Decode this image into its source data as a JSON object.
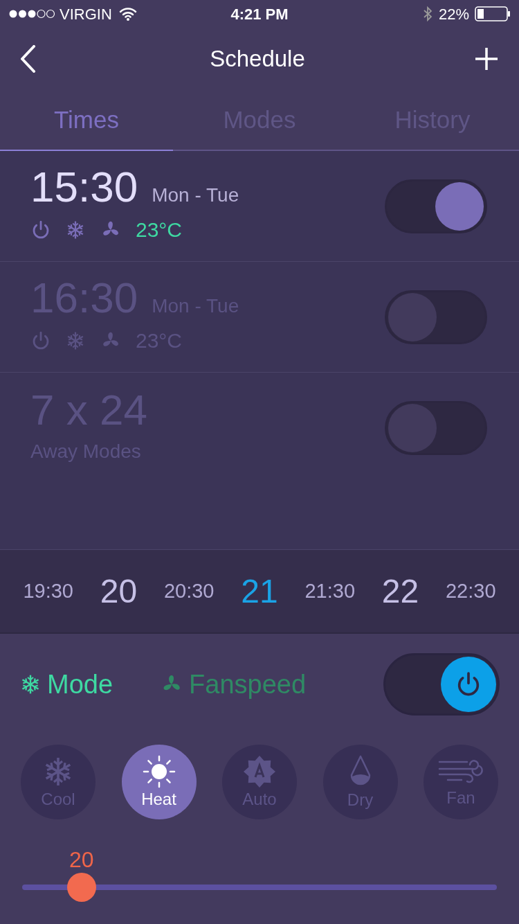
{
  "status_bar": {
    "carrier": "VIRGIN",
    "time": "4:21 PM",
    "battery": "22%"
  },
  "nav": {
    "title": "Schedule"
  },
  "tabs": [
    {
      "label": "Times",
      "selected": true
    },
    {
      "label": "Modes",
      "selected": false
    },
    {
      "label": "History",
      "selected": false
    }
  ],
  "schedules": [
    {
      "kind": "time",
      "time": "15:30",
      "days": "Mon - Tue",
      "temperature": "23°C",
      "on": true
    },
    {
      "kind": "time",
      "time": "16:30",
      "days": "Mon - Tue",
      "temperature": "23°C",
      "on": false
    },
    {
      "kind": "away",
      "title": "7 x 24",
      "subtitle": "Away Modes",
      "on": false
    }
  ],
  "timeline": [
    {
      "label": "19:30",
      "kind": "half",
      "selected": false
    },
    {
      "label": "20",
      "kind": "hour",
      "selected": false
    },
    {
      "label": "20:30",
      "kind": "half",
      "selected": false
    },
    {
      "label": "21",
      "kind": "hour",
      "selected": true
    },
    {
      "label": "21:30",
      "kind": "half",
      "selected": false
    },
    {
      "label": "22",
      "kind": "hour",
      "selected": false
    },
    {
      "label": "22:30",
      "kind": "half",
      "selected": false
    }
  ],
  "control_tabs": [
    {
      "label": "Mode",
      "kind": "mode",
      "selected": true
    },
    {
      "label": "Fanspeed",
      "kind": "fan",
      "selected": false
    }
  ],
  "power": {
    "on": true
  },
  "modes": [
    {
      "label": "Cool",
      "kind": "cool",
      "selected": false
    },
    {
      "label": "Heat",
      "kind": "heat",
      "selected": true
    },
    {
      "label": "Auto",
      "kind": "auto",
      "selected": false
    },
    {
      "label": "Dry",
      "kind": "dry",
      "selected": false
    },
    {
      "label": "Fan",
      "kind": "fan",
      "selected": false
    }
  ],
  "temperature_slider": {
    "value": "20",
    "level": 0.125
  }
}
